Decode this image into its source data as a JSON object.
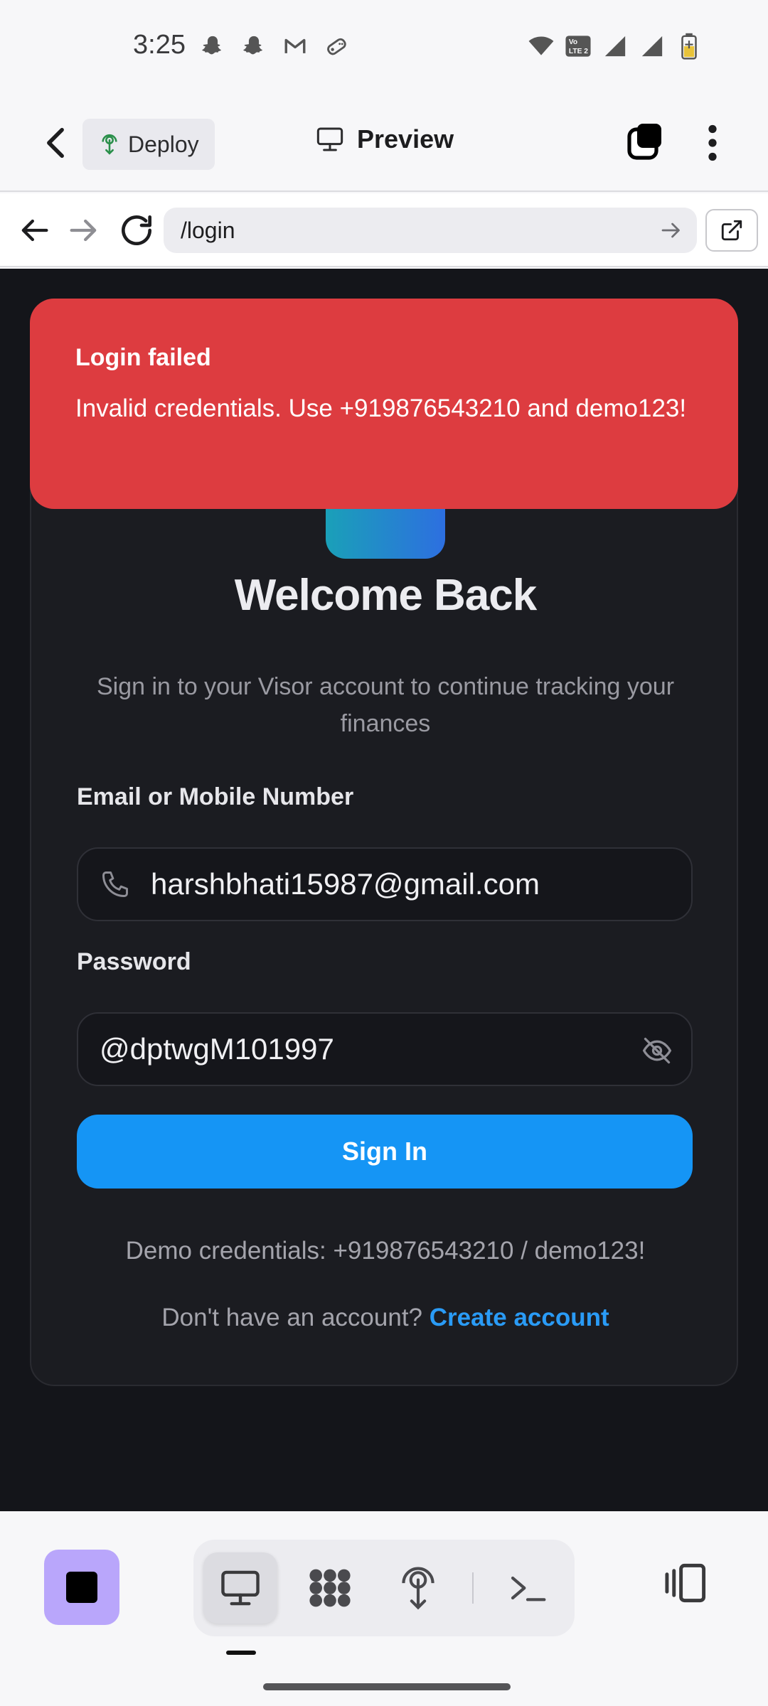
{
  "status_bar": {
    "time": "3:25",
    "left_icons": [
      "snapchat-icon",
      "snapchat-icon",
      "gmail-icon",
      "game-controller-icon"
    ],
    "right_icons": [
      "wifi-icon",
      "volte-icon",
      "signal-icon",
      "signal-icon",
      "battery-charging-icon"
    ]
  },
  "header": {
    "deploy_label": "Deploy",
    "preview_label": "Preview"
  },
  "url_bar": {
    "path": "/login"
  },
  "toast": {
    "title": "Login failed",
    "message": "Invalid credentials. Use +919876543210 and demo123!",
    "color": "#dd3c40"
  },
  "login": {
    "title": "Welcome Back",
    "subtitle": "Sign in to your Visor account to continue tracking your finances",
    "email_label": "Email or Mobile Number",
    "email_value": "harshbhati15987@gmail.com",
    "password_label": "Password",
    "password_value": "@dptwgM101997",
    "sign_in_label": "Sign In",
    "demo_credentials": "Demo credentials: +919876543210 / demo123!",
    "no_account_text": "Don't have an account?",
    "create_account_label": "Create account",
    "accent_color": "#1595f5"
  },
  "toolbar": {
    "active_tool": "preview",
    "tools": [
      "preview-icon",
      "apps-icon",
      "deploy-icon",
      "terminal-icon"
    ]
  }
}
